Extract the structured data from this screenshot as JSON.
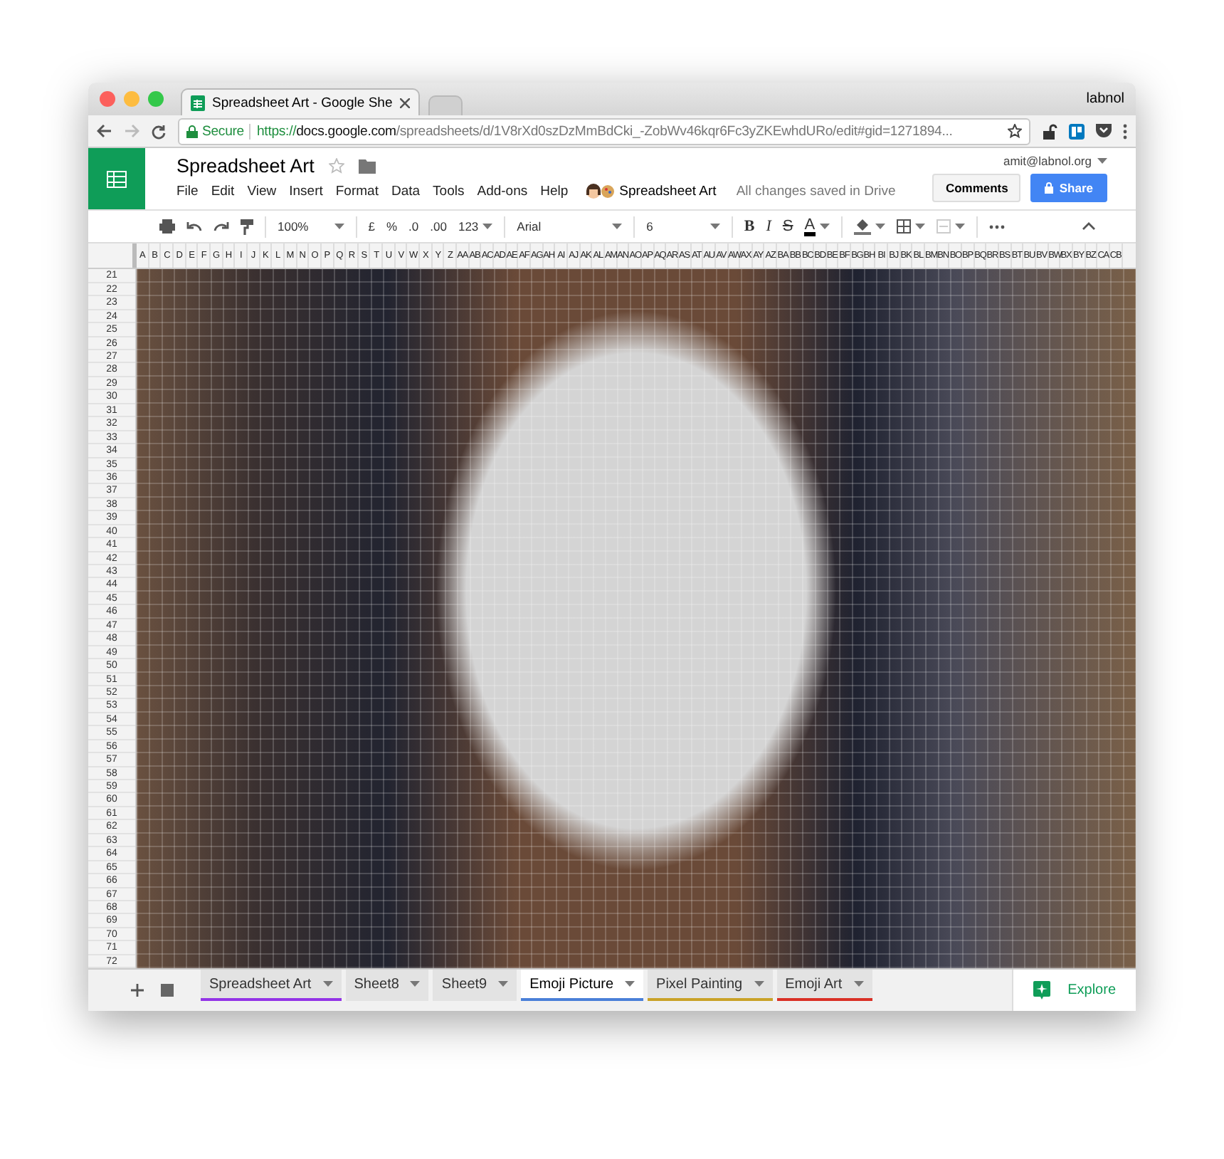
{
  "browser": {
    "tabs": [
      {
        "title": "Spreadsheet Art - Google She",
        "selected": true
      },
      {
        "selected": false
      }
    ],
    "profile": "labnol",
    "address": {
      "secure_label": "Secure",
      "scheme": "https://",
      "host": "docs.google.com",
      "path": "/spreadsheets/d/1V8rXd0szDzMmBdCki_-ZobWv46kqr6Fc3yZKEwhdURo/edit#gid=1271894..."
    }
  },
  "document": {
    "title": "Spreadsheet Art",
    "account": "amit@labnol.org",
    "comments_button": "Comments",
    "share_button": "Share",
    "menu": [
      "File",
      "Edit",
      "View",
      "Insert",
      "Format",
      "Data",
      "Tools",
      "Add-ons",
      "Help"
    ],
    "addon_label": "Spreadsheet Art",
    "save_status": "All changes saved in Drive"
  },
  "toolbar": {
    "zoom": "100%",
    "currency": "£",
    "percent": "%",
    "decrease_decimal": ".0",
    "increase_decimal": ".00",
    "number_format": "123",
    "font": "Arial",
    "font_size": "6",
    "bold": "B",
    "italic": "I",
    "strikethrough": "S",
    "text_color": "A"
  },
  "grid": {
    "columns": [
      "A",
      "B",
      "C",
      "D",
      "E",
      "F",
      "G",
      "H",
      "I",
      "J",
      "K",
      "L",
      "M",
      "N",
      "O",
      "P",
      "Q",
      "R",
      "S",
      "T",
      "U",
      "V",
      "W",
      "X",
      "Y",
      "Z",
      "AA",
      "AB",
      "AC",
      "AD",
      "AE",
      "AF",
      "AG",
      "AH",
      "AI",
      "AJ",
      "AK",
      "AL",
      "AM",
      "AN",
      "AO",
      "AP",
      "AQ",
      "AR",
      "AS",
      "AT",
      "AU",
      "AV",
      "AW",
      "AX",
      "AY",
      "AZ",
      "BA",
      "BB",
      "BC",
      "BD",
      "BE",
      "BF",
      "BG",
      "BH",
      "BI",
      "BJ",
      "BK",
      "BL",
      "BM",
      "BN",
      "BO",
      "BP",
      "BQ",
      "BR",
      "BS",
      "BT",
      "BU",
      "BV",
      "BW",
      "BX",
      "BY",
      "BZ",
      "CA",
      "CB"
    ],
    "rows": [
      "21",
      "22",
      "23",
      "24",
      "25",
      "26",
      "27",
      "28",
      "29",
      "30",
      "31",
      "32",
      "33",
      "34",
      "35",
      "36",
      "37",
      "38",
      "39",
      "40",
      "41",
      "42",
      "43",
      "44",
      "45",
      "46",
      "47",
      "48",
      "49",
      "50",
      "51",
      "52",
      "53",
      "54",
      "55",
      "56",
      "57",
      "58",
      "59",
      "60",
      "61",
      "62",
      "63",
      "64",
      "65",
      "66",
      "67",
      "68",
      "69",
      "70",
      "71",
      "72"
    ]
  },
  "sheet_tabs": [
    {
      "label": "Spreadsheet Art",
      "color": "#9334e6",
      "selected": false
    },
    {
      "label": "Sheet8",
      "selected": false
    },
    {
      "label": "Sheet9",
      "selected": false
    },
    {
      "label": "Emoji Picture",
      "color": "#4a7fd8",
      "selected": true
    },
    {
      "label": "Pixel Painting",
      "color": "#c9a227",
      "selected": false
    },
    {
      "label": "Emoji Art",
      "color": "#d93025",
      "selected": false
    }
  ],
  "explore_button": "Explore"
}
